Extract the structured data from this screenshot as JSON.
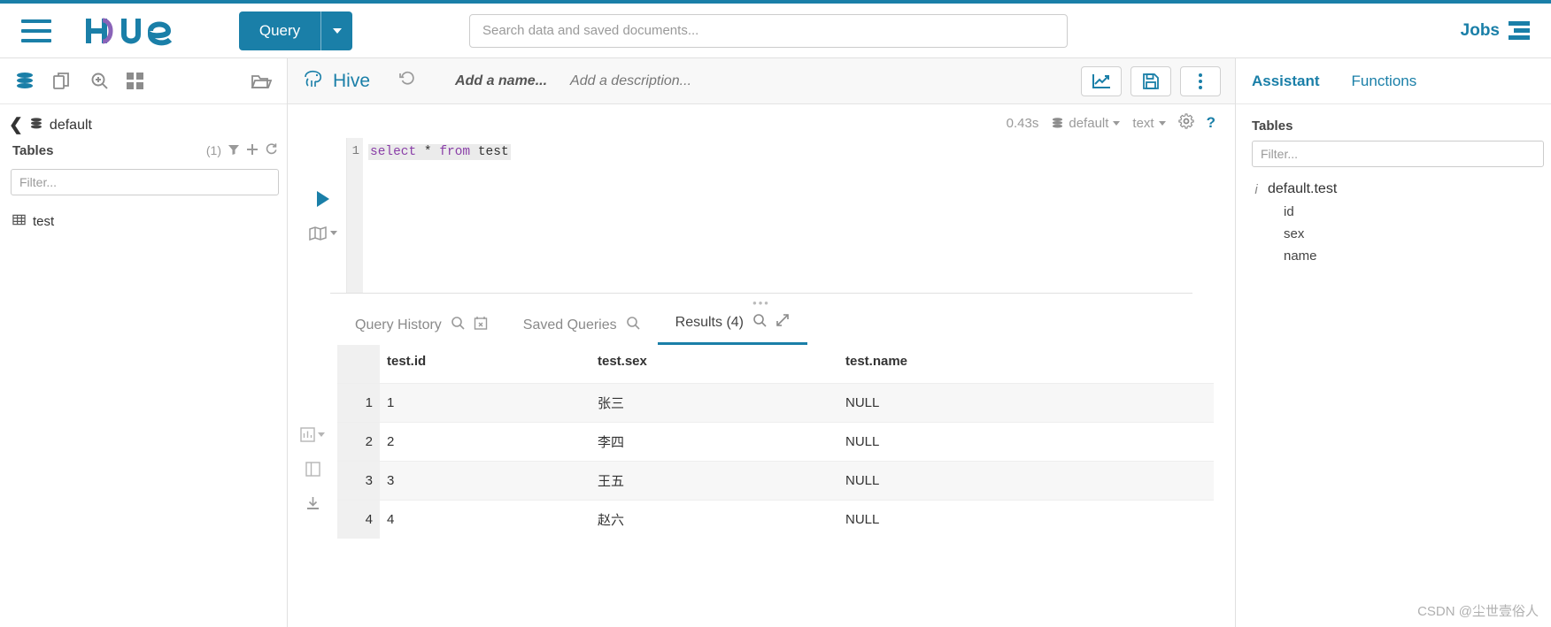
{
  "navbar": {
    "logo_text": "Hue",
    "query_button": {
      "label": "Query",
      "caret": "caret-down-icon"
    },
    "search": {
      "placeholder": "Search data and saved documents...",
      "value": ""
    },
    "jobs_label": "Jobs",
    "jobs_icon": "jobs-stack-icon",
    "hamburger_icon": "hamburger-menu-icon"
  },
  "left_panel": {
    "icons": [
      {
        "name": "database-icon",
        "active": true
      },
      {
        "name": "documents-icon",
        "active": false
      },
      {
        "name": "search-zoom-icon",
        "active": false
      },
      {
        "name": "grid-apps-icon",
        "active": false
      },
      {
        "name": "folder-icon",
        "active": false
      }
    ],
    "breadcrumb": {
      "back_icon": "chevron-left-icon",
      "db_icon": "database-icon",
      "db_name": "default"
    },
    "tables_header": {
      "title": "Tables",
      "count": "(1)",
      "filter_icon": "funnel-filter-icon",
      "add_icon": "plus-icon",
      "refresh_icon": "refresh-icon"
    },
    "filter": {
      "placeholder": "Filter...",
      "value": ""
    },
    "tables": [
      {
        "name": "test",
        "icon": "table-icon"
      }
    ]
  },
  "editor": {
    "engine": "Hive",
    "engine_icon": "hive-elephant-icon",
    "history_icon": "history-revert-icon",
    "name_placeholder": "Add a name...",
    "description_placeholder": "Add a description...",
    "buttons": [
      {
        "name": "chart-trending-icon"
      },
      {
        "name": "save-disk-icon"
      },
      {
        "name": "kebab-menu-icon"
      }
    ],
    "info": {
      "duration": "0.43s",
      "database": "default",
      "format": "text",
      "gear_icon": "gear-settings-icon",
      "help_icon": "question-help-icon"
    },
    "execute_icon": "play-execute-icon",
    "map_icon": "map-book-icon",
    "line_numbers": [
      "1"
    ],
    "sql_tokens": [
      {
        "text": "select",
        "type": "keyword"
      },
      {
        "text": " * ",
        "type": "plain"
      },
      {
        "text": "from",
        "type": "keyword"
      },
      {
        "text": " test",
        "type": "plain"
      }
    ],
    "sql_text": "select * from test"
  },
  "result_tabs": [
    {
      "label": "Query History",
      "icons": [
        "search-icon",
        "calendar-x-icon"
      ],
      "active": false
    },
    {
      "label": "Saved Queries",
      "icons": [
        "search-icon"
      ],
      "active": false
    },
    {
      "label": "Results (4)",
      "icons": [
        "search-icon",
        "expand-arrows-icon"
      ],
      "active": true
    }
  ],
  "result_gutter_icons": [
    {
      "name": "grid-view-icon",
      "active": true
    },
    {
      "name": "chart-bar-icon",
      "active": false
    },
    {
      "name": "columns-view-icon",
      "active": false
    },
    {
      "name": "download-icon",
      "active": false
    }
  ],
  "results": {
    "columns": [
      "",
      "test.id",
      "test.sex",
      "test.name"
    ],
    "rows": [
      {
        "num": "1",
        "id": "1",
        "sex": "张三",
        "name": "NULL"
      },
      {
        "num": "2",
        "id": "2",
        "sex": "李四",
        "name": "NULL"
      },
      {
        "num": "3",
        "id": "3",
        "sex": "王五",
        "name": "NULL"
      },
      {
        "num": "4",
        "id": "4",
        "sex": "赵六",
        "name": "NULL"
      }
    ]
  },
  "assistant": {
    "tabs": [
      {
        "label": "Assistant",
        "active": true
      },
      {
        "label": "Functions",
        "active": false
      }
    ],
    "section_title": "Tables",
    "filter": {
      "placeholder": "Filter...",
      "value": ""
    },
    "tree": {
      "info_icon": "info-icon",
      "table": "default.test",
      "columns": [
        "id",
        "sex",
        "name"
      ]
    }
  },
  "watermark": "CSDN @尘世壹俗人",
  "colors": {
    "brand": "#1a7fa8",
    "accent_purple": "#8a3fa8",
    "muted": "#9a9a9a",
    "border": "#e0e0e0"
  }
}
